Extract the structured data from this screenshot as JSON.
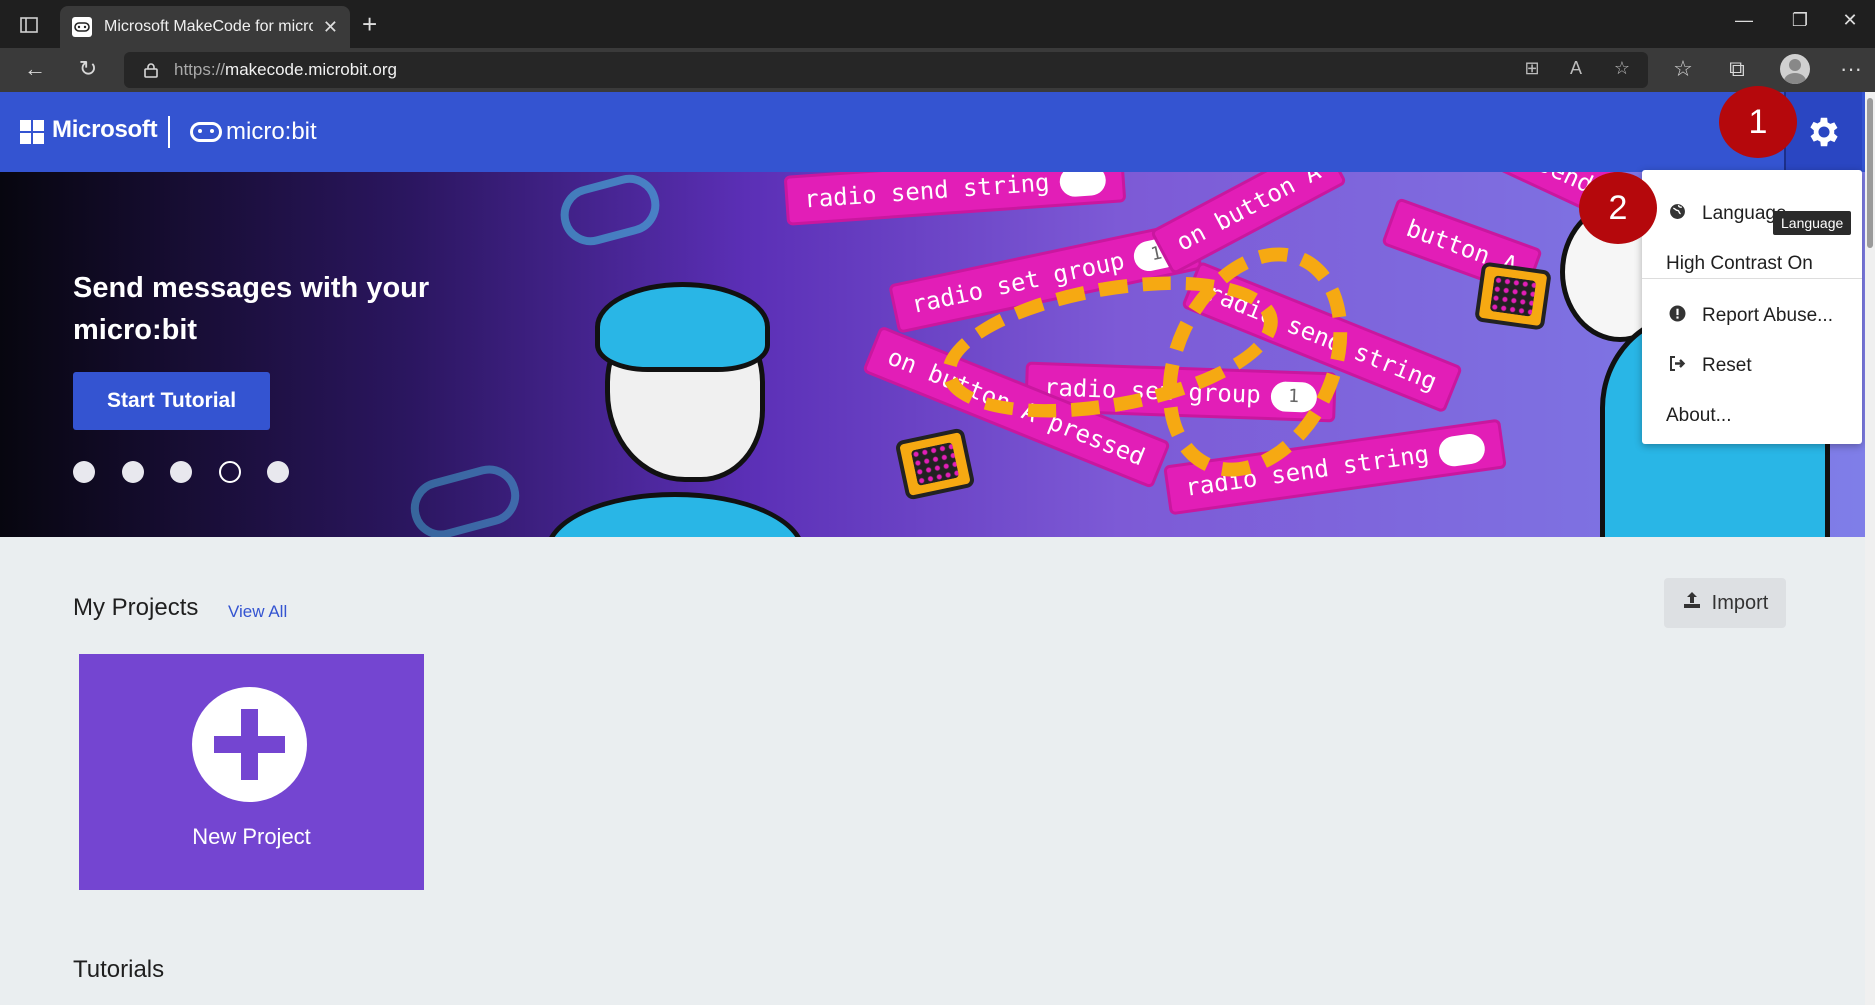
{
  "browser": {
    "tab_title": "Microsoft MakeCode for micro:bit",
    "url_prefix": "https://",
    "url_host": "makecode.microbit.org"
  },
  "header": {
    "microsoft_text": "Microsoft",
    "microbit_text": "micro:bit",
    "brand_color": "#3454d1"
  },
  "hero": {
    "title": "Send messages with your micro:bit",
    "button_label": "Start Tutorial",
    "carousel_dots": 5,
    "active_dot_index": 3,
    "blocks": [
      "radio send string",
      "radio set group",
      "radio send string",
      "radio set group",
      "on button A pressed",
      "radio send string",
      "on button A",
      "button A",
      "radio send string"
    ]
  },
  "settings_menu": {
    "items": [
      {
        "label": "Language",
        "icon": "globe-icon"
      },
      {
        "label": "High Contrast On",
        "icon": ""
      },
      {
        "label": "Report Abuse...",
        "icon": "exclamation-icon"
      },
      {
        "label": "Reset",
        "icon": "sign-out-icon"
      },
      {
        "label": "About...",
        "icon": ""
      }
    ],
    "tooltip": "Language"
  },
  "callouts": [
    "1",
    "2"
  ],
  "main": {
    "my_projects_title": "My Projects",
    "view_all_label": "View All",
    "import_label": "Import",
    "new_project_label": "New Project",
    "tutorials_title": "Tutorials"
  }
}
